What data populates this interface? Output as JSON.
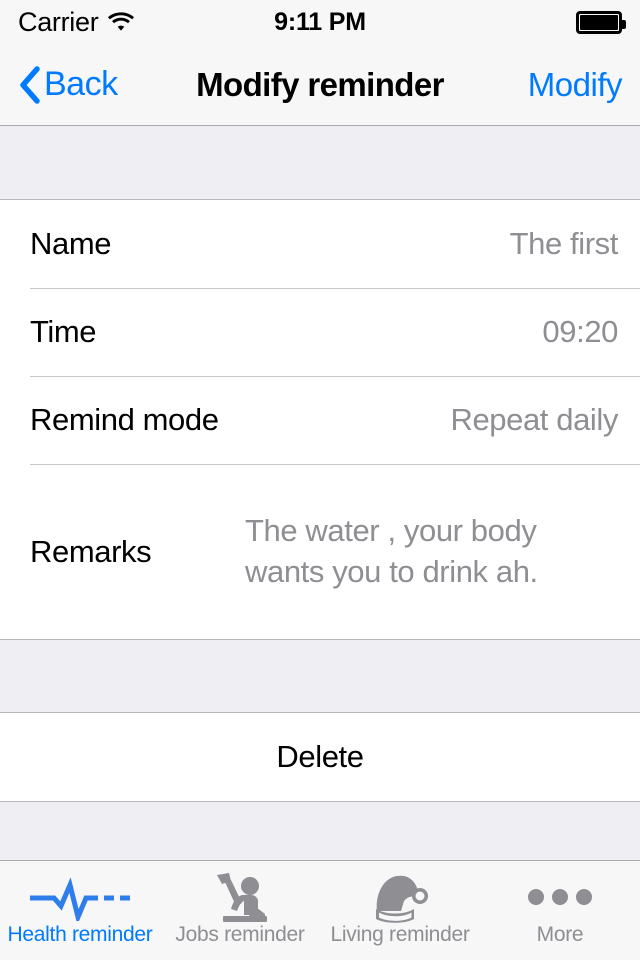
{
  "status_bar": {
    "carrier": "Carrier",
    "wifi_icon": "wifi-icon",
    "time": "9:11 PM",
    "battery_icon": "battery-full-icon"
  },
  "nav_bar": {
    "back_icon": "chevron-left-icon",
    "back_label": "Back",
    "title": "Modify reminder",
    "action_label": "Modify"
  },
  "form": {
    "rows": [
      {
        "label": "Name",
        "value": "The first"
      },
      {
        "label": "Time",
        "value": "09:20"
      },
      {
        "label": "Remind mode",
        "value": "Repeat daily"
      },
      {
        "label": "Remarks",
        "value": "The water , your body wants you to drink ah."
      }
    ]
  },
  "delete": {
    "label": "Delete"
  },
  "tab_bar": {
    "items": [
      {
        "label": "Health reminder",
        "icon": "heartbeat-ecg-icon",
        "active": true
      },
      {
        "label": "Jobs reminder",
        "icon": "worker-hammer-icon",
        "active": false
      },
      {
        "label": "Living reminder",
        "icon": "santa-hat-icon",
        "active": false
      },
      {
        "label": "More",
        "icon": "ellipsis-icon",
        "active": false
      }
    ]
  },
  "colors": {
    "accent": "#007aff",
    "value_text": "#8e8e93",
    "group_background": "#eeeef3",
    "bar_background": "#f7f7f8"
  }
}
